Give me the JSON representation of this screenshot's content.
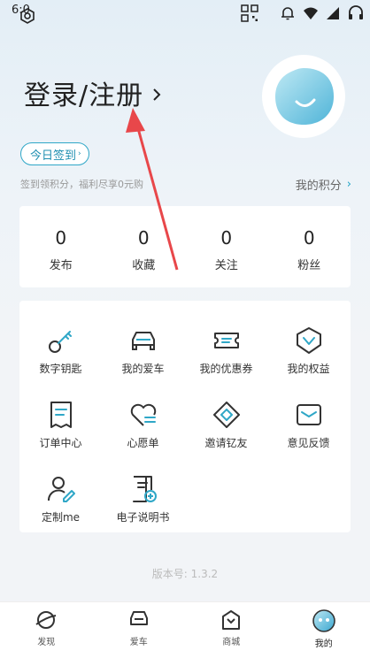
{
  "status_bar": {
    "time": "6:0"
  },
  "header": {
    "login_label": "登录/注册"
  },
  "checkin": {
    "button_label": "今日签到",
    "tip": "签到领积分，福利尽享0元购",
    "points_label": "我的积分"
  },
  "stats": [
    {
      "value": "0",
      "label": "发布"
    },
    {
      "value": "0",
      "label": "收藏"
    },
    {
      "value": "0",
      "label": "关注"
    },
    {
      "value": "0",
      "label": "粉丝"
    }
  ],
  "menu": [
    {
      "label": "数字钥匙",
      "icon": "key-icon"
    },
    {
      "label": "我的爱车",
      "icon": "car-icon"
    },
    {
      "label": "我的优惠券",
      "icon": "coupon-icon"
    },
    {
      "label": "我的权益",
      "icon": "rights-icon"
    },
    {
      "label": "订单中心",
      "icon": "order-icon"
    },
    {
      "label": "心愿单",
      "icon": "wishlist-icon"
    },
    {
      "label": "邀请钇友",
      "icon": "invite-icon"
    },
    {
      "label": "意见反馈",
      "icon": "feedback-icon"
    },
    {
      "label": "定制me",
      "icon": "custom-me-icon"
    },
    {
      "label": "电子说明书",
      "icon": "manual-icon"
    }
  ],
  "version": "版本号: 1.3.2",
  "tabs": [
    {
      "label": "发现",
      "icon": "planet-icon"
    },
    {
      "label": "爱车",
      "icon": "car-front-icon"
    },
    {
      "label": "商城",
      "icon": "shop-icon"
    },
    {
      "label": "我的",
      "icon": "profile-face-icon",
      "active": true
    }
  ],
  "colors": {
    "accent": "#2fa7c7",
    "annotation_arrow": "#e8474a"
  }
}
